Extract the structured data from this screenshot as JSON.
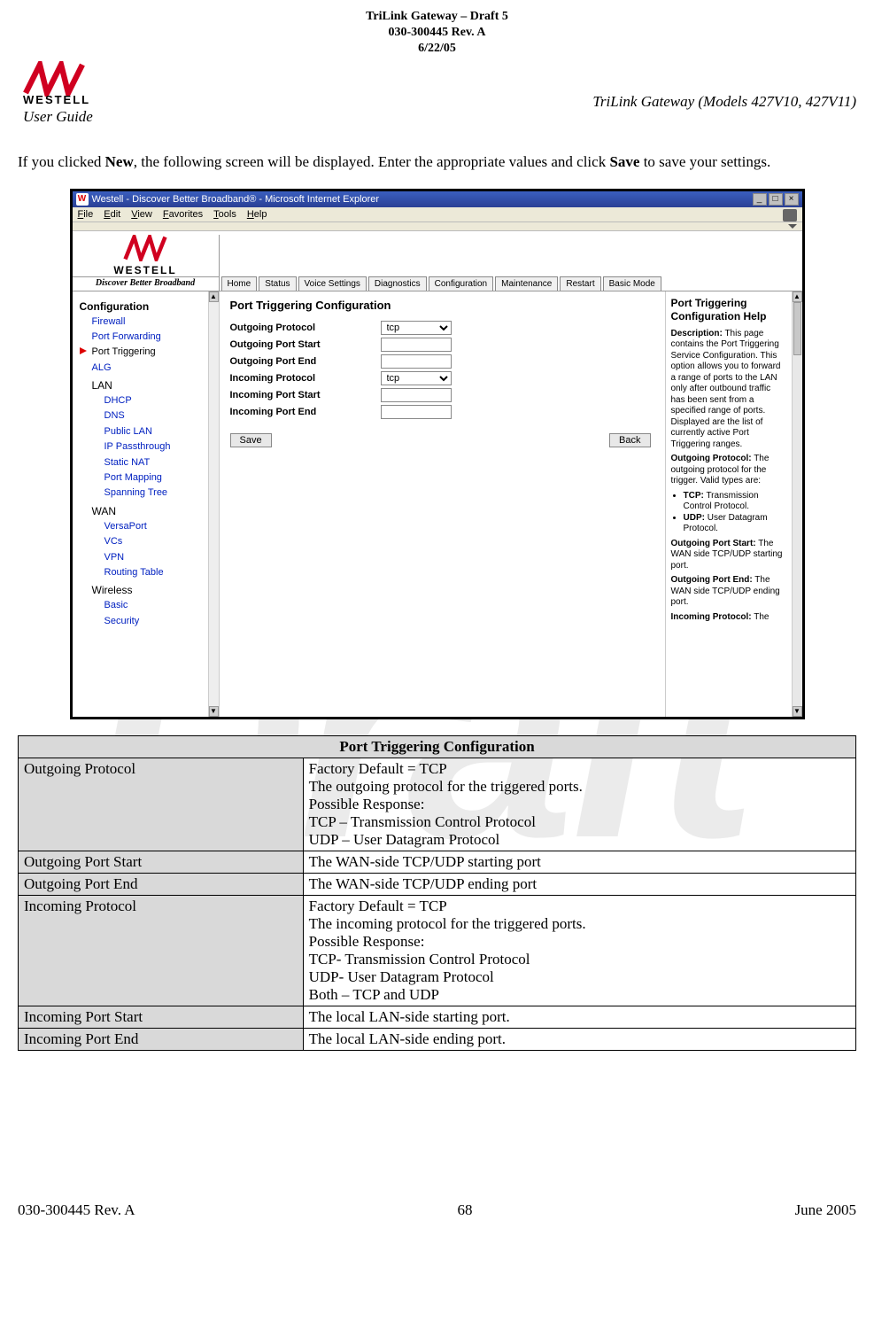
{
  "watermark": "Draft",
  "header": {
    "line1": "TriLink Gateway – Draft 5",
    "line2": "030-300445 Rev. A",
    "line3": "6/22/05",
    "company": "WESTELL",
    "user_guide": "User Guide",
    "right": "TriLink Gateway (Models 427V10, 427V11)"
  },
  "intro": {
    "pre": "If you clicked ",
    "b1": "New",
    "mid": ", the following screen will be displayed. Enter the appropriate values and click ",
    "b2": "Save",
    "post": " to save your settings."
  },
  "screenshot": {
    "window_title": "Westell - Discover Better Broadband® - Microsoft Internet Explorer",
    "menubar": [
      "File",
      "Edit",
      "View",
      "Favorites",
      "Tools",
      "Help"
    ],
    "brand": "WESTELL",
    "tagline": "Discover Better Broadband",
    "tabs": [
      "Home",
      "Status",
      "Voice Settings",
      "Diagnostics",
      "Configuration",
      "Maintenance",
      "Restart",
      "Basic Mode"
    ],
    "sidebar": {
      "heading1": "Configuration",
      "items1": [
        "Firewall",
        "Port Forwarding",
        "Port Triggering",
        "ALG"
      ],
      "heading2": "LAN",
      "items2": [
        "DHCP",
        "DNS",
        "Public LAN",
        "IP Passthrough",
        "Static NAT",
        "Port Mapping",
        "Spanning Tree"
      ],
      "heading3": "WAN",
      "items3": [
        "VersaPort",
        "VCs",
        "VPN",
        "Routing Table"
      ],
      "heading4": "Wireless",
      "items4": [
        "Basic",
        "Security"
      ]
    },
    "main": {
      "title": "Port Triggering Configuration",
      "fields": {
        "out_proto": "Outgoing Protocol",
        "out_start": "Outgoing Port Start",
        "out_end": "Outgoing Port End",
        "in_proto": "Incoming Protocol",
        "in_start": "Incoming Port Start",
        "in_end": "Incoming Port End"
      },
      "select_value": "tcp",
      "save": "Save",
      "back": "Back"
    },
    "help": {
      "title": "Port Triggering Configuration Help",
      "desc_label": "Description:",
      "desc_text": " This page contains the Port Triggering Service Configuration. This option allows you to forward a range of ports to the LAN only after outbound traffic has been sent from a specified range of ports. Displayed are the list of currently active Port Triggering ranges.",
      "out_proto_label": "Outgoing Protocol:",
      "out_proto_text": " The outgoing protocol for the trigger. Valid types are:",
      "bullet1_label": "TCP:",
      "bullet1_text": " Transmission Control Protocol.",
      "bullet2_label": "UDP:",
      "bullet2_text": " User Datagram Protocol.",
      "out_start_label": "Outgoing Port Start:",
      "out_start_text": " The WAN side TCP/UDP starting port.",
      "out_end_label": "Outgoing Port End:",
      "out_end_text": " The WAN side TCP/UDP ending port.",
      "in_proto_label": "Incoming Protocol:",
      "in_proto_text": " The"
    }
  },
  "table": {
    "title": "Port Triggering Configuration",
    "rows": [
      {
        "k": "Outgoing Protocol",
        "v": "Factory Default = TCP\nThe outgoing protocol for the triggered ports.\nPossible Response:\nTCP – Transmission Control Protocol\nUDP – User Datagram Protocol"
      },
      {
        "k": "Outgoing Port Start",
        "v": "The WAN-side TCP/UDP starting port"
      },
      {
        "k": "Outgoing Port End",
        "v": "The WAN-side TCP/UDP ending port"
      },
      {
        "k": "Incoming Protocol",
        "v": "Factory Default = TCP\nThe incoming protocol for the triggered ports.\nPossible Response:\nTCP- Transmission Control Protocol\nUDP- User Datagram Protocol\nBoth – TCP and UDP"
      },
      {
        "k": "Incoming Port Start",
        "v": "The local LAN-side starting port."
      },
      {
        "k": "Incoming Port End",
        "v": "The local LAN-side ending port."
      }
    ]
  },
  "footer": {
    "left": "030-300445 Rev. A",
    "center": "68",
    "right": "June 2005"
  }
}
